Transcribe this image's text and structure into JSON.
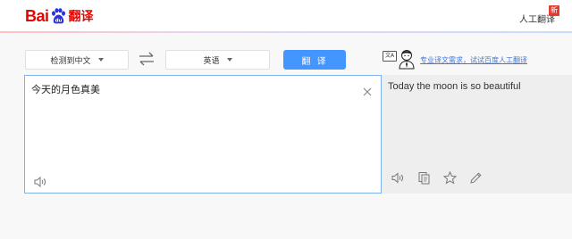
{
  "header": {
    "logo_text": "Bai",
    "logo_suffix": "翻译",
    "human_translation_link": "人工翻译",
    "new_badge": "新"
  },
  "language_bar": {
    "source_language": "检测到中文",
    "target_language": "英语",
    "translate_button": "翻 译"
  },
  "pro_service": {
    "icon_text": "文A",
    "link_text": "专业译文需求，试试百度人工翻译"
  },
  "source": {
    "text": "今天的月色真美"
  },
  "result": {
    "text": "Today the moon is so beautiful"
  },
  "icons": {
    "swap": "swap-arrows-icon",
    "clear": "close-icon",
    "speaker": "speaker-icon",
    "copy": "copy-icon",
    "favorite": "star-icon",
    "edit": "pencil-icon"
  },
  "colors": {
    "brand_red": "#e10602",
    "button_blue": "#4395ff",
    "link_blue": "#3b78e7",
    "input_border": "#7fb3f0"
  }
}
